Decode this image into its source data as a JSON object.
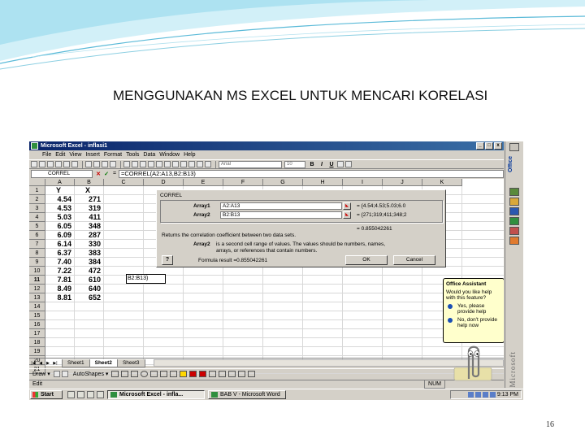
{
  "slide": {
    "title": "MENGGUNAKAN MS EXCEL UNTUK MENCARI KORELASI",
    "page_number": "16"
  },
  "window": {
    "title": "Microsoft Excel - inflasi1",
    "controls": [
      "_",
      "□",
      "x"
    ]
  },
  "menu": [
    "File",
    "Edit",
    "View",
    "Insert",
    "Format",
    "Tools",
    "Data",
    "Window",
    "Help"
  ],
  "toolbar": {
    "font_name": "Arial",
    "font_size": "10",
    "bold": "B",
    "italic": "I",
    "underline": "U"
  },
  "formula_bar": {
    "name_box": "CORREL",
    "cancel": "✕",
    "enter": "✓",
    "equals": "=",
    "formula": "=CORREL(A2:A13,B2:B13)"
  },
  "grid": {
    "columns": [
      "A",
      "B",
      "C",
      "D",
      "E",
      "F",
      "G",
      "H",
      "I",
      "J",
      "K"
    ],
    "rows": [
      "1",
      "2",
      "3",
      "4",
      "5",
      "6",
      "7",
      "8",
      "9",
      "10",
      "11",
      "12",
      "13",
      "14",
      "15",
      "16",
      "17",
      "18",
      "19",
      "20",
      "21"
    ],
    "header_row": {
      "a": "Y",
      "b": "X"
    },
    "data": [
      {
        "a": "4.54",
        "b": "271"
      },
      {
        "a": "4.53",
        "b": "319"
      },
      {
        "a": "5.03",
        "b": "411"
      },
      {
        "a": "6.05",
        "b": "348"
      },
      {
        "a": "6.09",
        "b": "287"
      },
      {
        "a": "6.14",
        "b": "330"
      },
      {
        "a": "6.37",
        "b": "383"
      },
      {
        "a": "7.40",
        "b": "384"
      },
      {
        "a": "7.22",
        "b": "472"
      },
      {
        "a": "7.81",
        "b": "610"
      },
      {
        "a": "8.49",
        "b": "640"
      },
      {
        "a": "8.81",
        "b": "652"
      }
    ],
    "edit_cell": "B2:B13)"
  },
  "dialog": {
    "title": "CORREL",
    "array1_label": "Array1",
    "array1_value": "A2:A13",
    "array1_result": "= {4.54;4.53;5.03;6.0",
    "array2_label": "Array2",
    "array2_value": "B2:B13",
    "array2_result": "= {271;319;411;348;2",
    "correl_result": "= 0.855042261",
    "description": "Returns the correlation coefficient between two data sets.",
    "note_label": "Array2",
    "note_line1": "is a second cell range of values. The values should be numbers, names,",
    "note_line2": "arrays, or references that contain numbers.",
    "help": "?",
    "formula_result": "Formula result =0.855042261",
    "ok": "OK",
    "cancel": "Cancel"
  },
  "sheets": [
    "Sheet1",
    "Sheet2",
    "Sheet3"
  ],
  "active_sheet": "Sheet2",
  "drawing": {
    "draw": "Draw ▾",
    "autoshapes": "AutoShapes ▾"
  },
  "status": {
    "mode": "Edit",
    "num": "NUM"
  },
  "assistant": {
    "title": "Office Assistant",
    "question": "Would you like help with this feature?",
    "yes": "Yes, please provide help",
    "no": "No, don't provide help now"
  },
  "office_bar": {
    "label": "Office",
    "brand": "Microsoft"
  },
  "taskbar": {
    "start": "Start",
    "tasks": [
      "Microsoft Excel - infla...",
      "BAB V - Microsoft Word"
    ],
    "clock": "9:13 PM"
  }
}
